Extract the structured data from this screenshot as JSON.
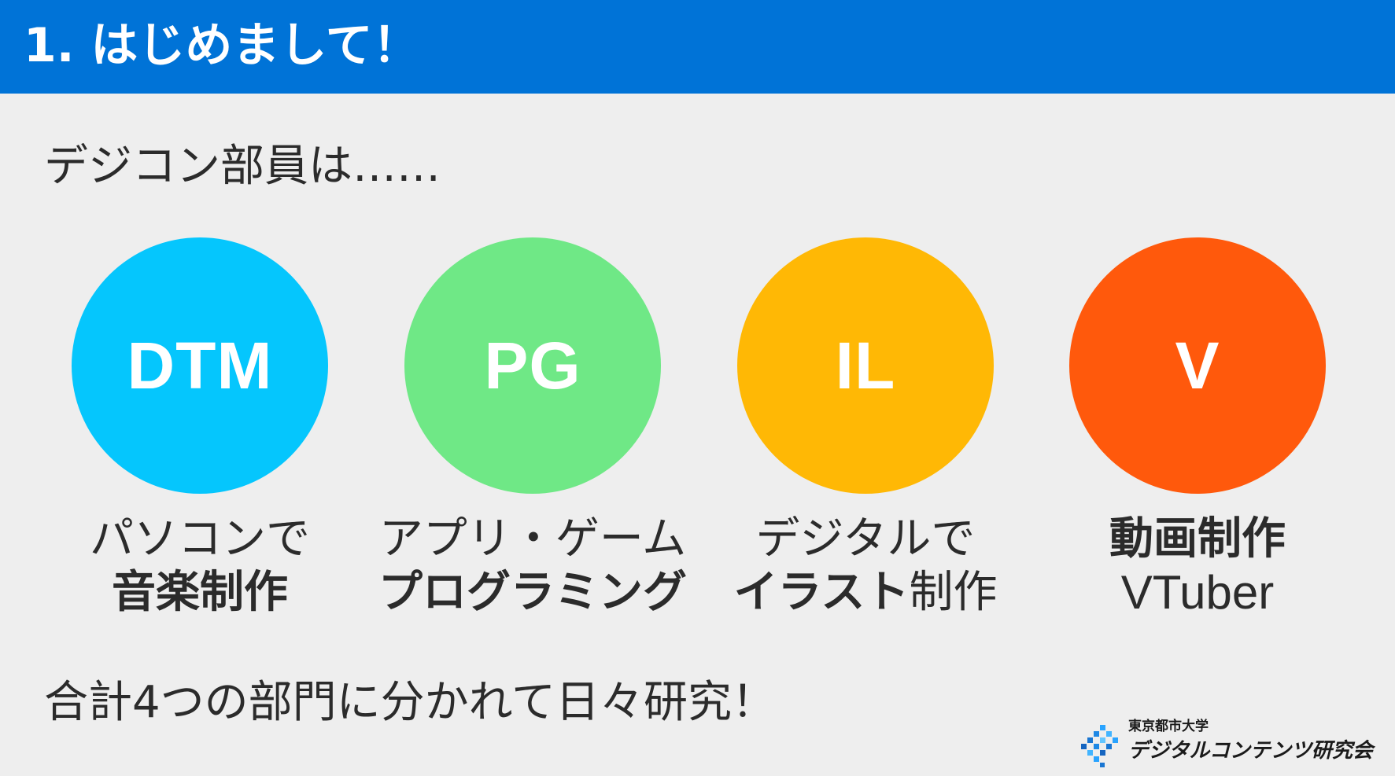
{
  "header": {
    "title": "1. はじめまして！",
    "color": "#0073d7"
  },
  "lead": "デジコン部員は……",
  "divisions": [
    {
      "code": "DTM",
      "color": "#05c6fd",
      "caption_line1": "パソコンで",
      "caption_line2": "音楽制作"
    },
    {
      "code": "PG",
      "color": "#6fe886",
      "caption_line1": "アプリ・ゲーム",
      "caption_line2": "プログラミング"
    },
    {
      "code": "IL",
      "color": "#ffb805",
      "caption_line1": "デジタルで",
      "caption_line2_bold": "イラスト",
      "caption_line2_regular": "制作"
    },
    {
      "code": "V",
      "color": "#ff590c",
      "caption_line1": "動画制作",
      "caption_line2": "VTuber"
    }
  ],
  "summary": "合計4つの部門に分かれて日々研究！",
  "logo": {
    "university": "東京都市大学",
    "club_name": "デジタルコンテンツ研究会",
    "icon": "pixel-diamond-logo-icon",
    "accent_color": "#1976d2"
  }
}
